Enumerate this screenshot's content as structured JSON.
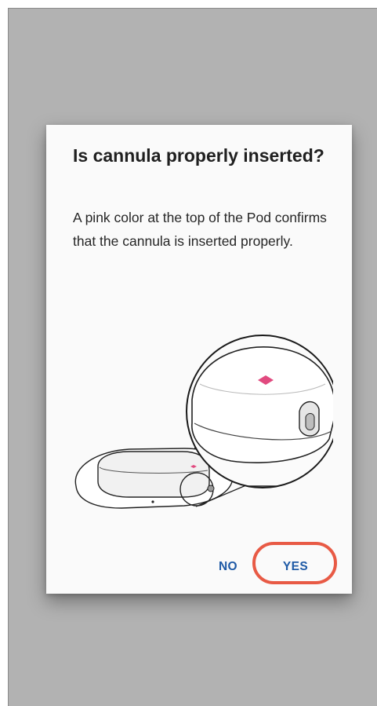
{
  "dialog": {
    "title": "Is cannula properly inserted?",
    "message": "A pink color at the top of the Pod confirms that the cannula is inserted properly.",
    "illustration_icon": "pod-cannula-illustration"
  },
  "actions": {
    "no_label": "NO",
    "yes_label": "YES",
    "yes_highlighted": true
  },
  "colors": {
    "scrim": "#b2b2b2",
    "dialog_background": "#fafafa",
    "button_text": "#1f5aa6",
    "highlight_ring": "#e85a45",
    "pod_indicator": "#e14a7f"
  }
}
